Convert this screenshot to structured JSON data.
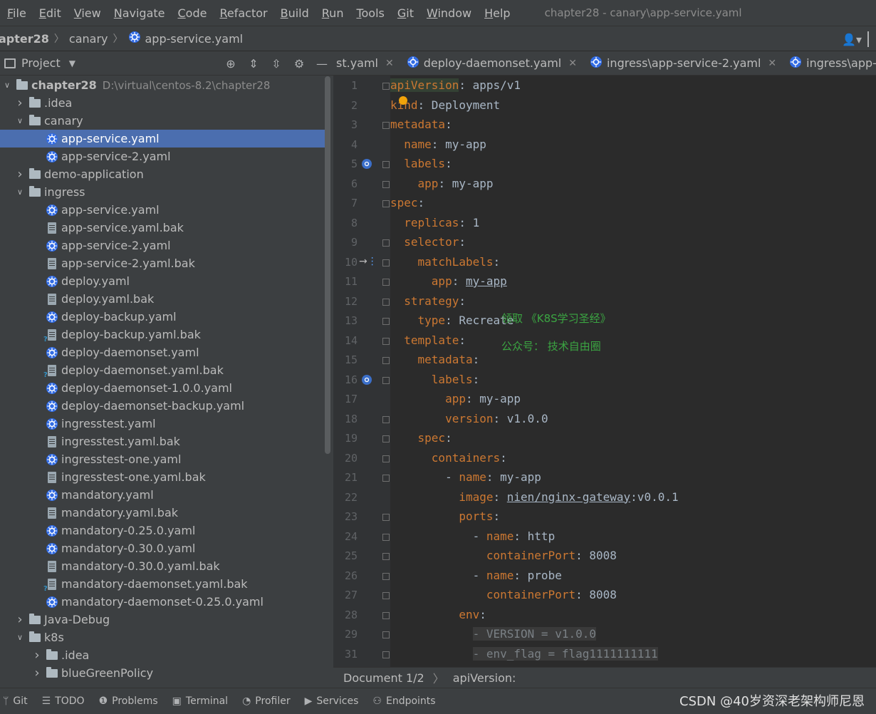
{
  "menu": {
    "items": [
      "File",
      "Edit",
      "View",
      "Navigate",
      "Code",
      "Refactor",
      "Build",
      "Run",
      "Tools",
      "Git",
      "Window",
      "Help"
    ],
    "window_title": "chapter28 - canary\\app-service.yaml"
  },
  "breadcrumb": {
    "project": "apter28",
    "folder": "canary",
    "file": "app-service.yaml"
  },
  "project_panel": {
    "title": "Project",
    "tree": [
      {
        "label": "chapter28",
        "path": "D:\\virtual\\centos-8.2\\chapter28",
        "type": "module",
        "indent": 0,
        "arrow": "down"
      },
      {
        "label": ".idea",
        "type": "folder",
        "indent": 1,
        "arrow": "right"
      },
      {
        "label": "canary",
        "type": "folder",
        "indent": 1,
        "arrow": "down"
      },
      {
        "label": "app-service.yaml",
        "type": "k8s",
        "indent": 2,
        "selected": true
      },
      {
        "label": "app-service-2.yaml",
        "type": "k8s",
        "indent": 2
      },
      {
        "label": "demo-application",
        "type": "folder",
        "indent": 1,
        "arrow": "right"
      },
      {
        "label": "ingress",
        "type": "folder",
        "indent": 1,
        "arrow": "down"
      },
      {
        "label": "app-service.yaml",
        "type": "k8s",
        "indent": 2
      },
      {
        "label": "app-service.yaml.bak",
        "type": "file",
        "indent": 2
      },
      {
        "label": "app-service-2.yaml",
        "type": "k8s",
        "indent": 2
      },
      {
        "label": "app-service-2.yaml.bak",
        "type": "file",
        "indent": 2
      },
      {
        "label": "deploy.yaml",
        "type": "k8s",
        "indent": 2
      },
      {
        "label": "deploy.yaml.bak",
        "type": "file",
        "indent": 2
      },
      {
        "label": "deploy-backup.yaml",
        "type": "k8s",
        "indent": 2
      },
      {
        "label": "deploy-backup.yaml.bak",
        "type": "fileq",
        "indent": 2
      },
      {
        "label": "deploy-daemonset.yaml",
        "type": "k8s",
        "indent": 2
      },
      {
        "label": "deploy-daemonset.yaml.bak",
        "type": "fileq",
        "indent": 2
      },
      {
        "label": "deploy-daemonset-1.0.0.yaml",
        "type": "k8s",
        "indent": 2
      },
      {
        "label": "deploy-daemonset-backup.yaml",
        "type": "k8s",
        "indent": 2
      },
      {
        "label": "ingresstest.yaml",
        "type": "k8s",
        "indent": 2
      },
      {
        "label": "ingresstest.yaml.bak",
        "type": "file",
        "indent": 2
      },
      {
        "label": "ingresstest-one.yaml",
        "type": "k8s",
        "indent": 2
      },
      {
        "label": "ingresstest-one.yaml.bak",
        "type": "file",
        "indent": 2
      },
      {
        "label": "mandatory.yaml",
        "type": "k8s",
        "indent": 2
      },
      {
        "label": "mandatory.yaml.bak",
        "type": "file",
        "indent": 2
      },
      {
        "label": "mandatory-0.25.0.yaml",
        "type": "k8s",
        "indent": 2
      },
      {
        "label": "mandatory-0.30.0.yaml",
        "type": "k8s",
        "indent": 2
      },
      {
        "label": "mandatory-0.30.0.yaml.bak",
        "type": "file",
        "indent": 2
      },
      {
        "label": "mandatory-daemonset.yaml.bak",
        "type": "fileq",
        "indent": 2
      },
      {
        "label": "mandatory-daemonset-0.25.0.yaml",
        "type": "k8s",
        "indent": 2
      },
      {
        "label": "Java-Debug",
        "type": "folder",
        "indent": 1,
        "arrow": "right"
      },
      {
        "label": "k8s",
        "type": "folder",
        "indent": 1,
        "arrow": "down"
      },
      {
        "label": ".idea",
        "type": "folder",
        "indent": 2,
        "arrow": "right"
      },
      {
        "label": "blueGreenPolicy",
        "type": "folder",
        "indent": 2,
        "arrow": "right"
      }
    ]
  },
  "tabs": [
    {
      "label": "st.yaml",
      "k8s": false
    },
    {
      "label": "deploy-daemonset.yaml",
      "k8s": true
    },
    {
      "label": "ingress\\app-service-2.yaml",
      "k8s": true
    },
    {
      "label": "ingress\\app-service.yaml",
      "k8s": true
    }
  ],
  "editor": {
    "lines": [
      {
        "n": "1",
        "key": "apiVersion",
        "value": " apps/v1",
        "indent": ""
      },
      {
        "n": "2",
        "key": "kind",
        "value": " Deployment",
        "indent": ""
      },
      {
        "n": "3",
        "key": "metadata",
        "value": "",
        "indent": ""
      },
      {
        "n": "4",
        "key": "name",
        "value": " my-app",
        "indent": "  "
      },
      {
        "n": "5",
        "key": "labels",
        "value": "",
        "indent": "  "
      },
      {
        "n": "6",
        "key": "app",
        "value": " my-app",
        "indent": "    "
      },
      {
        "n": "7",
        "key": "spec",
        "value": "",
        "indent": ""
      },
      {
        "n": "8",
        "key": "replicas",
        "value": " 1",
        "indent": "  "
      },
      {
        "n": "9",
        "key": "selector",
        "value": "",
        "indent": "  "
      },
      {
        "n": "10",
        "key": "matchLabels",
        "value": "",
        "indent": "    "
      },
      {
        "n": "11",
        "key": "app",
        "value": "my-app",
        "indent": "      ",
        "underline": true
      },
      {
        "n": "12",
        "key": "strategy",
        "value": "",
        "indent": "  "
      },
      {
        "n": "13",
        "key": "type",
        "value": " Recreate",
        "indent": "    "
      },
      {
        "n": "14",
        "key": "template",
        "value": "",
        "indent": "  "
      },
      {
        "n": "15",
        "key": "metadata",
        "value": "",
        "indent": "    "
      },
      {
        "n": "16",
        "key": "labels",
        "value": "",
        "indent": "      "
      },
      {
        "n": "17",
        "key": "app",
        "value": " my-app",
        "indent": "        "
      },
      {
        "n": "18",
        "key": "version",
        "value": " v1.0.0",
        "indent": "        "
      },
      {
        "n": "19",
        "key": "spec",
        "value": "",
        "indent": "    "
      },
      {
        "n": "20",
        "key": "containers",
        "value": "",
        "indent": "      "
      },
      {
        "n": "21",
        "key": "name",
        "value": " my-app",
        "indent": "        - "
      },
      {
        "n": "22",
        "key": "image",
        "value": "nien/nginx-gateway",
        "suffix": ":v0.0.1",
        "indent": "          ",
        "wavy": true
      },
      {
        "n": "23",
        "key": "ports",
        "value": "",
        "indent": "          "
      },
      {
        "n": "24",
        "key": "name",
        "value": " http",
        "indent": "            - "
      },
      {
        "n": "25",
        "key": "containerPort",
        "value": " 8008",
        "indent": "              "
      },
      {
        "n": "26",
        "key": "name",
        "value": " probe",
        "indent": "            - "
      },
      {
        "n": "27",
        "key": "containerPort",
        "value": " 8008",
        "indent": "              "
      },
      {
        "n": "28",
        "key": "env",
        "value": "",
        "indent": "          "
      },
      {
        "n": "29",
        "text": "- VERSION = v1.0.0",
        "indent": "            ",
        "env": true
      },
      {
        "n": "31",
        "text": "- env_flag = flag1111111111",
        "indent": "            ",
        "env": true
      }
    ],
    "watermark_1": "领取 《K8S学习圣经》",
    "watermark_2": "公众号： 技术自由圈"
  },
  "editor_breadcrumb": {
    "doc": "Document 1/2",
    "node": "apiVersion:"
  },
  "bottom_tools": [
    "Git",
    "TODO",
    "Problems",
    "Terminal",
    "Profiler",
    "Services",
    "Endpoints"
  ],
  "watermark_csdn": "CSDN @40岁资深老架构师尼恩"
}
